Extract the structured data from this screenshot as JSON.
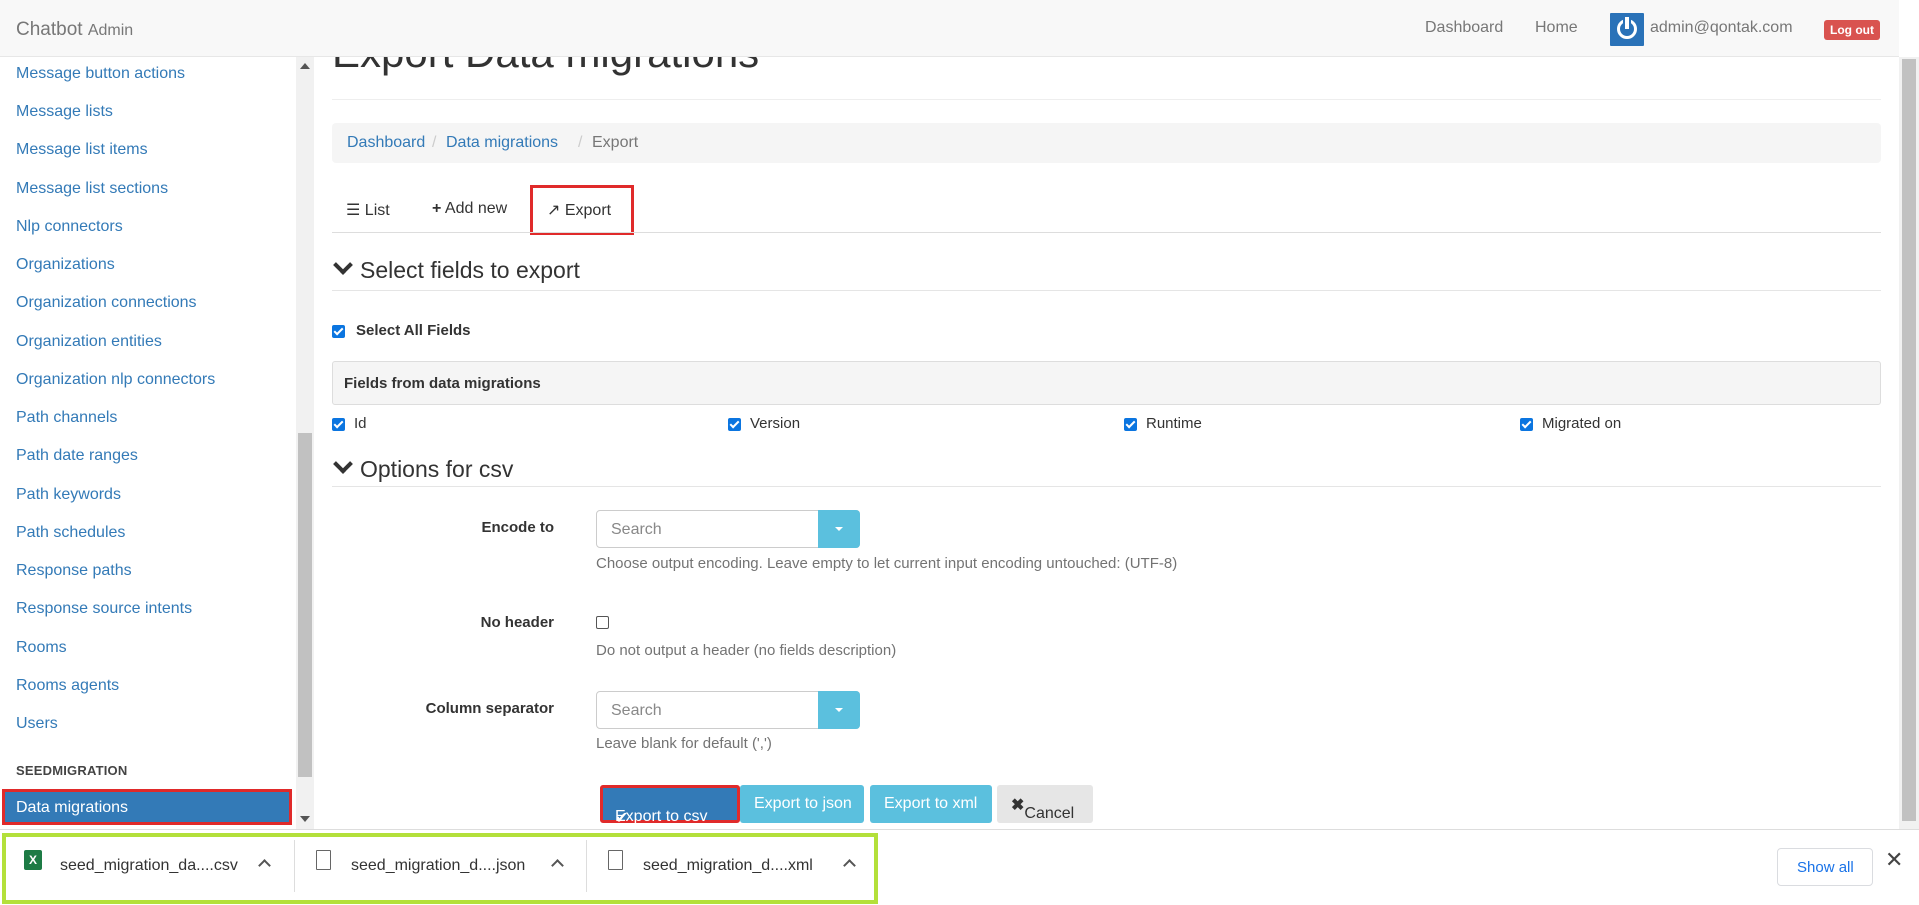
{
  "navbar": {
    "brand": "Chatbot",
    "brand_sub": "Admin",
    "links": [
      "Dashboard",
      "Home"
    ],
    "user_email": "admin@qontak.com",
    "logout_label": "Log out"
  },
  "sidebar": {
    "items": [
      "Message button actions",
      "Message lists",
      "Message list items",
      "Message list sections",
      "Nlp connectors",
      "Organizations",
      "Organization connections",
      "Organization entities",
      "Organization nlp connectors",
      "Path channels",
      "Path date ranges",
      "Path keywords",
      "Path schedules",
      "Response paths",
      "Response source intents",
      "Rooms",
      "Rooms agents",
      "Users"
    ],
    "section_header": "SEEDMIGRATION",
    "active_item": "Data migrations"
  },
  "main": {
    "title": "Export Data migrations",
    "breadcrumb": [
      "Dashboard",
      "Data migrations",
      "Export"
    ],
    "tabs": {
      "list": "List",
      "add_new": "Add new",
      "export": "Export"
    },
    "fields_section_title": "Select fields to export",
    "select_all_label": "Select All Fields",
    "fields_panel_title": "Fields from data migrations",
    "fields": [
      {
        "label": "Id",
        "checked": true
      },
      {
        "label": "Version",
        "checked": true
      },
      {
        "label": "Runtime",
        "checked": true
      },
      {
        "label": "Migrated on",
        "checked": true
      }
    ],
    "options_section_title": "Options for csv",
    "encode_label": "Encode to",
    "encode_placeholder": "Search",
    "encode_help": "Choose output encoding. Leave empty to let current input encoding untouched: (UTF-8)",
    "no_header_label": "No header",
    "no_header_checked": false,
    "no_header_help": "Do not output a header (no fields description)",
    "separator_label": "Column separator",
    "separator_placeholder": "Search",
    "separator_help": "Leave blank for default (',')",
    "buttons": {
      "csv": "Export to csv",
      "json": "Export to json",
      "xml": "Export to xml",
      "cancel": "Cancel"
    }
  },
  "downloads": {
    "items": [
      {
        "name": "seed_migration_da....csv",
        "icon": "excel-file-icon"
      },
      {
        "name": "seed_migration_d....json",
        "icon": "file-icon"
      },
      {
        "name": "seed_migration_d....xml",
        "icon": "file-icon"
      }
    ],
    "show_all_label": "Show all"
  },
  "colors": {
    "link": "#337ab7",
    "highlight_red": "#e02a2a",
    "highlight_green": "#b3e03a",
    "info": "#5bc0de",
    "danger": "#d9534f"
  }
}
